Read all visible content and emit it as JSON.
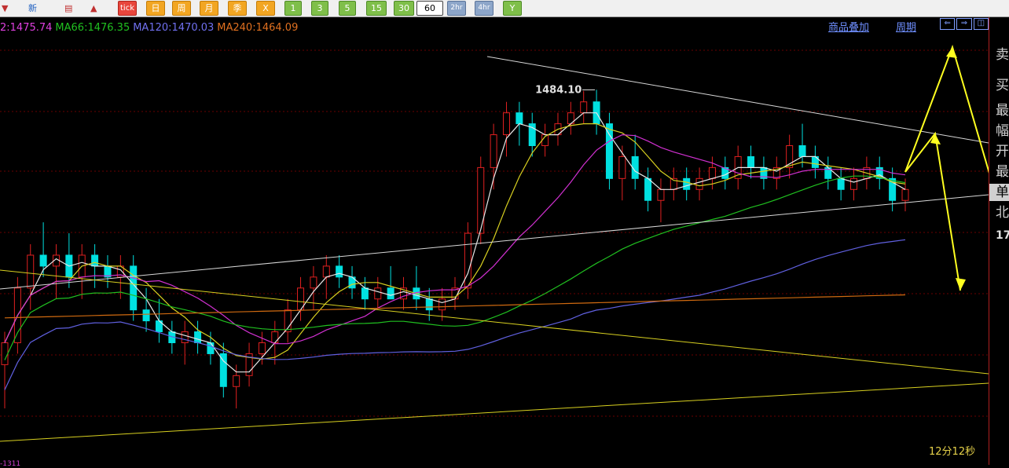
{
  "toolbar": {
    "buttons": [
      {
        "label": "",
        "style": "icon"
      },
      {
        "label": "新",
        "style": "plain"
      },
      {
        "label": "",
        "style": "icon"
      },
      {
        "label": "",
        "style": "icon"
      },
      {
        "label": "tick",
        "style": "r"
      },
      {
        "label": "日",
        "style": "o"
      },
      {
        "label": "周",
        "style": "o"
      },
      {
        "label": "月",
        "style": "o"
      },
      {
        "label": "季",
        "style": "o"
      },
      {
        "label": "X",
        "style": "o"
      },
      {
        "label": "1",
        "style": "g"
      },
      {
        "label": "3",
        "style": "g"
      },
      {
        "label": "5",
        "style": "g"
      },
      {
        "label": "15",
        "style": "g"
      },
      {
        "label": "30",
        "style": "g"
      },
      {
        "label": "60",
        "style": "sel"
      },
      {
        "label": "2hr",
        "style": "d"
      },
      {
        "label": "4hr",
        "style": "d"
      },
      {
        "label": "Y",
        "style": "g"
      }
    ]
  },
  "header": {
    "overlay_link": "商品叠加",
    "period_link": "周期"
  },
  "legend": [
    {
      "text": "2:1475.74",
      "color": "#e040e0"
    },
    {
      "text": "MA66:1476.35",
      "color": "#20c020"
    },
    {
      "text": "MA120:1470.03",
      "color": "#7070f0"
    },
    {
      "text": "MA240:1464.09",
      "color": "#e07020"
    }
  ],
  "countdown": "12分12秒",
  "side_panel": {
    "items": [
      "卖",
      "买",
      "最",
      "幅",
      "开",
      "最",
      "单",
      "北"
    ],
    "highlighted_index": 6,
    "number": "17"
  },
  "bottom_text": "-1311",
  "chart_data": {
    "type": "candlestick",
    "title": "",
    "annotations": [
      {
        "label": "1484.10",
        "kind": "high-marker"
      }
    ],
    "indicators": [
      "MA(short, white)",
      "MA(yellow)",
      "MA(magenta)",
      "MA66",
      "MA120",
      "MA240"
    ],
    "colors": {
      "up": "#e02020",
      "down": "#00e0e0",
      "grid": "#6a0000"
    },
    "price_range": [
      1452,
      1488
    ],
    "candles": [
      [
        1459,
        1462,
        1455,
        1461
      ],
      [
        1461,
        1467,
        1460,
        1466
      ],
      [
        1466,
        1470,
        1464,
        1469
      ],
      [
        1469,
        1472,
        1467,
        1468
      ],
      [
        1468,
        1470,
        1465,
        1469
      ],
      [
        1469,
        1471,
        1466,
        1467
      ],
      [
        1467,
        1470,
        1465,
        1469
      ],
      [
        1469,
        1470,
        1466,
        1468
      ],
      [
        1468,
        1469,
        1466,
        1467
      ],
      [
        1467,
        1469,
        1465,
        1468
      ],
      [
        1468,
        1469,
        1463,
        1464
      ],
      [
        1464,
        1466,
        1462,
        1463
      ],
      [
        1463,
        1465,
        1461,
        1462
      ],
      [
        1462,
        1463,
        1460,
        1461
      ],
      [
        1461,
        1463,
        1459,
        1462
      ],
      [
        1462,
        1463,
        1460,
        1461
      ],
      [
        1461,
        1462,
        1459,
        1460
      ],
      [
        1460,
        1461,
        1456,
        1457
      ],
      [
        1457,
        1459,
        1455,
        1458
      ],
      [
        1458,
        1461,
        1457,
        1460
      ],
      [
        1460,
        1462,
        1459,
        1461
      ],
      [
        1461,
        1463,
        1459,
        1462
      ],
      [
        1462,
        1465,
        1461,
        1464
      ],
      [
        1464,
        1467,
        1463,
        1466
      ],
      [
        1466,
        1468,
        1464,
        1467
      ],
      [
        1467,
        1469,
        1465,
        1468
      ],
      [
        1468,
        1469,
        1466,
        1467
      ],
      [
        1467,
        1468,
        1465,
        1466
      ],
      [
        1466,
        1467,
        1464,
        1465
      ],
      [
        1465,
        1467,
        1464,
        1466
      ],
      [
        1466,
        1468,
        1465,
        1465
      ],
      [
        1465,
        1467,
        1464,
        1466
      ],
      [
        1466,
        1468,
        1464,
        1465
      ],
      [
        1465,
        1466,
        1463,
        1464
      ],
      [
        1464,
        1466,
        1463,
        1465
      ],
      [
        1465,
        1467,
        1464,
        1466
      ],
      [
        1466,
        1472,
        1465,
        1471
      ],
      [
        1471,
        1478,
        1470,
        1477
      ],
      [
        1477,
        1481,
        1475,
        1480
      ],
      [
        1480,
        1483,
        1478,
        1482
      ],
      [
        1482,
        1483,
        1479,
        1481
      ],
      [
        1481,
        1482,
        1478,
        1479
      ],
      [
        1479,
        1481,
        1478,
        1480
      ],
      [
        1480,
        1482,
        1479,
        1481
      ],
      [
        1481,
        1483,
        1480,
        1482
      ],
      [
        1482,
        1484,
        1481,
        1483
      ],
      [
        1483,
        1484.1,
        1480,
        1481
      ],
      [
        1481,
        1482,
        1475,
        1476
      ],
      [
        1476,
        1479,
        1474,
        1478
      ],
      [
        1478,
        1480,
        1475,
        1476
      ],
      [
        1476,
        1477,
        1473,
        1474
      ],
      [
        1474,
        1476,
        1472,
        1475
      ],
      [
        1475,
        1477,
        1474,
        1476
      ],
      [
        1476,
        1477,
        1474,
        1475
      ],
      [
        1475,
        1477,
        1474,
        1476
      ],
      [
        1476,
        1478,
        1475,
        1477
      ],
      [
        1477,
        1478,
        1475,
        1476
      ],
      [
        1476,
        1479,
        1475,
        1478
      ],
      [
        1478,
        1479,
        1476,
        1477
      ],
      [
        1477,
        1478,
        1475,
        1476
      ],
      [
        1476,
        1478,
        1475,
        1477
      ],
      [
        1477,
        1480,
        1476,
        1479
      ],
      [
        1479,
        1481,
        1477,
        1478
      ],
      [
        1478,
        1479,
        1476,
        1477
      ],
      [
        1477,
        1478,
        1475,
        1476
      ],
      [
        1476,
        1477,
        1474,
        1475
      ],
      [
        1475,
        1477,
        1474,
        1476
      ],
      [
        1476,
        1478,
        1475,
        1477
      ],
      [
        1477,
        1478,
        1475,
        1476
      ],
      [
        1476,
        1477,
        1473,
        1474
      ],
      [
        1474,
        1476,
        1473,
        1475
      ]
    ]
  }
}
